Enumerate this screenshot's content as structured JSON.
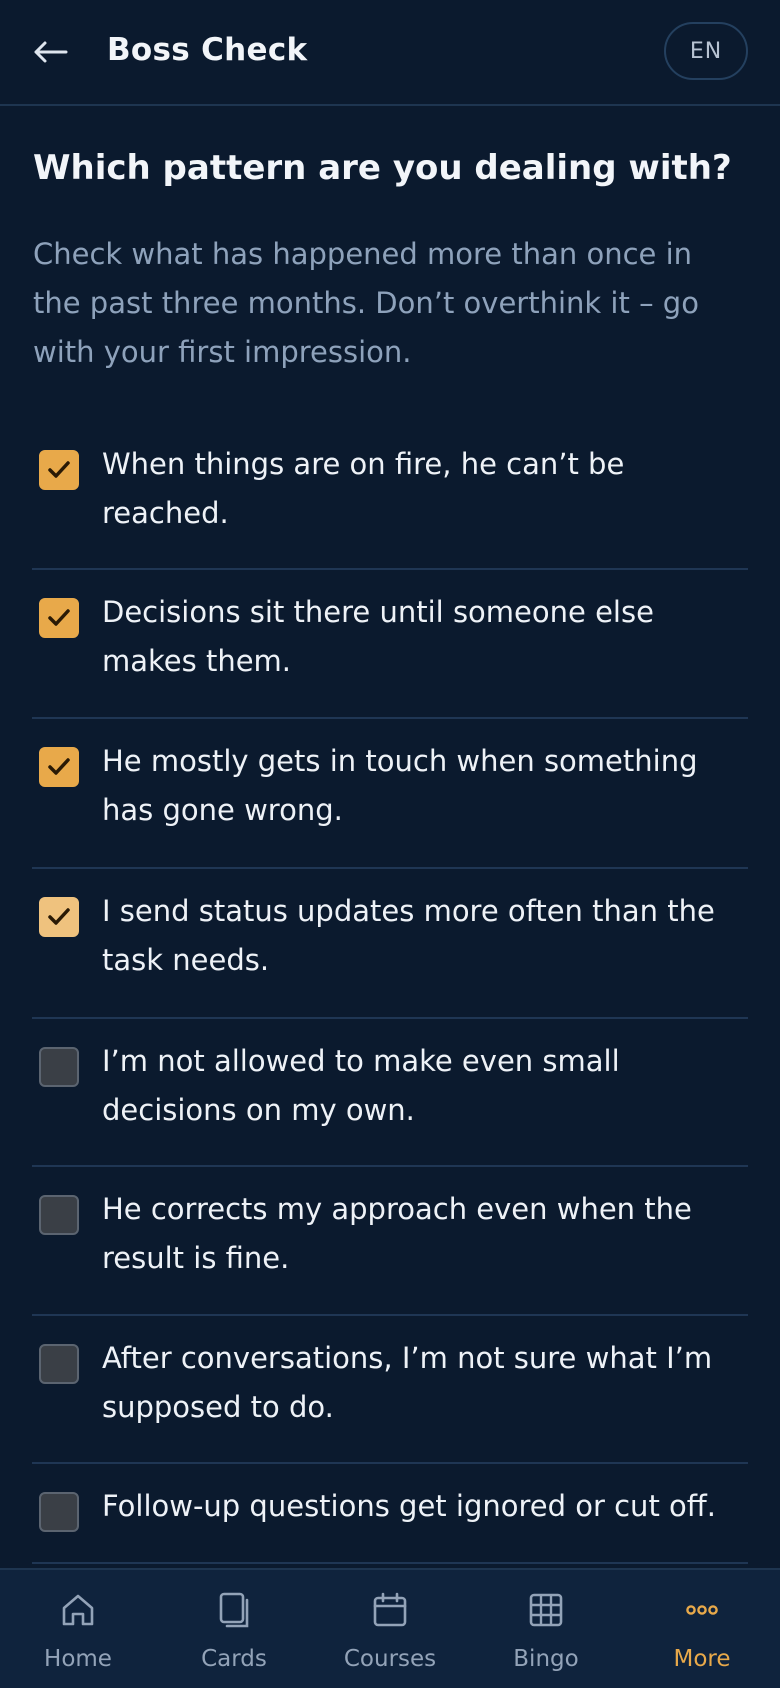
{
  "header": {
    "back_icon": "arrow-left-icon",
    "title": "Boss Check",
    "language": "EN"
  },
  "main": {
    "question": "Which pattern are you dealing with?",
    "instructions": "Check what has happened more than once in the past three months. Don’t overthink it – go with your first impression.",
    "items": [
      {
        "label": "When things are on fire, he can’t be reached.",
        "checked": true
      },
      {
        "label": "Decisions sit there until someone else makes them.",
        "checked": true
      },
      {
        "label": "He mostly gets in touch when something has gone wrong.",
        "checked": true
      },
      {
        "label": "I send status updates more often than the task needs.",
        "checked": true
      },
      {
        "label": "I’m not allowed to make even small decisions on my own.",
        "checked": false
      },
      {
        "label": "He corrects my approach even when the result is fine.",
        "checked": false
      },
      {
        "label": "After conversations, I’m not sure what I’m supposed to do.",
        "checked": false
      },
      {
        "label": "Follow-up questions get ignored or cut off.",
        "checked": false
      }
    ]
  },
  "tabbar": {
    "tabs": [
      {
        "label": "Home",
        "icon": "home-icon",
        "active": false
      },
      {
        "label": "Cards",
        "icon": "cards-icon",
        "active": false
      },
      {
        "label": "Courses",
        "icon": "calendar-icon",
        "active": false
      },
      {
        "label": "Bingo",
        "icon": "grid-icon",
        "active": false
      },
      {
        "label": "More",
        "icon": "more-dots-icon",
        "active": true
      }
    ]
  },
  "colors": {
    "background": "#0b1a2e",
    "accent": "#e8a94a",
    "muted_text": "#8ea2bb",
    "divider": "#1f3654"
  }
}
